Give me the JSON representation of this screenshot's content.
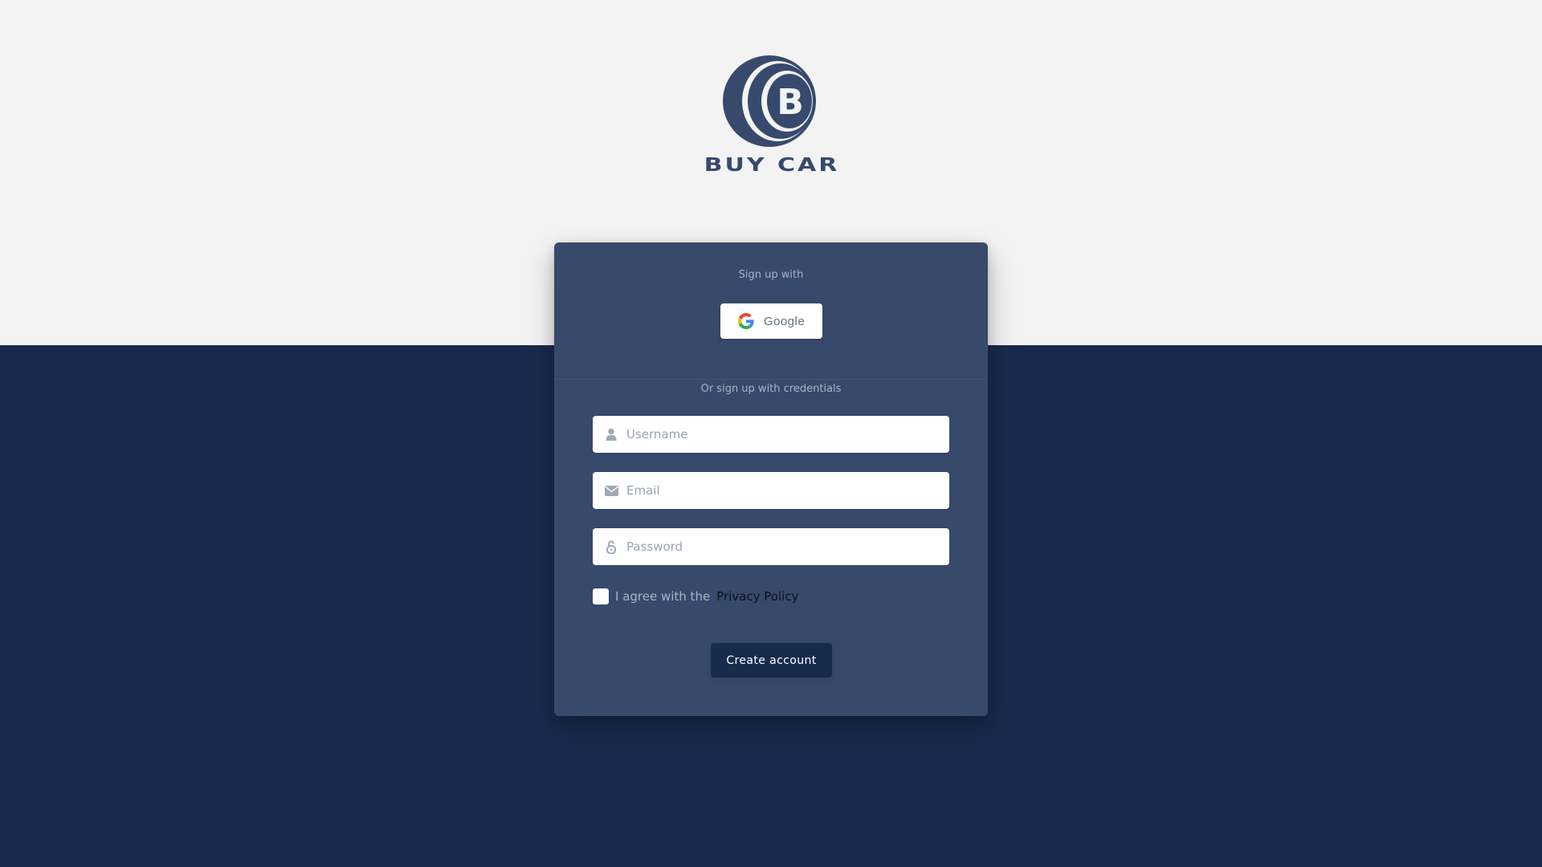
{
  "brand": {
    "logo_text": "BUY CAR",
    "logo_letter": "B",
    "primary_color": "#384a6b",
    "dark_color": "#182b4e",
    "background_color": "#f3f3f3"
  },
  "social": {
    "heading": "Sign up with",
    "google_label": "Google",
    "google_icon": "google-icon"
  },
  "credentials": {
    "heading": "Or sign up with credentials",
    "username": {
      "placeholder": "Username",
      "value": "",
      "icon": "user-icon"
    },
    "email": {
      "placeholder": "Email",
      "value": "",
      "icon": "envelope-icon"
    },
    "password": {
      "placeholder": "Password",
      "value": "",
      "icon": "lock-icon"
    }
  },
  "agreement": {
    "checked": false,
    "text": "I agree with the",
    "link_text": "Privacy Policy"
  },
  "submit": {
    "label": "Create account"
  }
}
